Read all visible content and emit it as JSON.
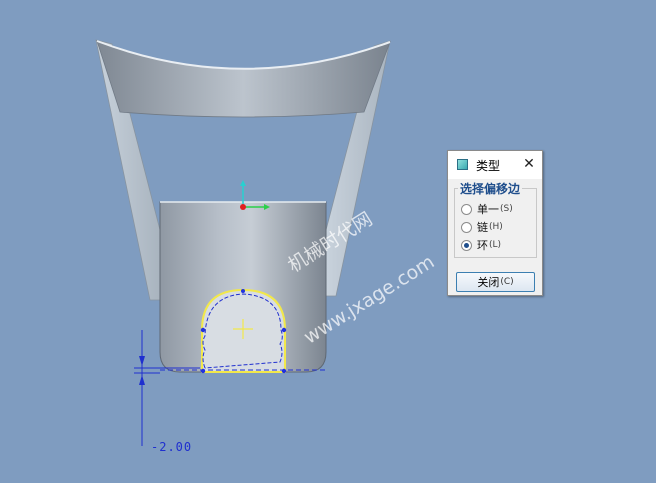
{
  "dialog": {
    "title": "类型",
    "close_glyph": "✕",
    "group_title": "选择偏移边",
    "options": [
      {
        "label": "单一",
        "key": "(S)",
        "checked": false
      },
      {
        "label": "链",
        "key": "(H)",
        "checked": false
      },
      {
        "label": "环",
        "key": "(L)",
        "checked": true
      }
    ],
    "close_button_label": "关闭",
    "close_button_key": "(C)"
  },
  "viewport": {
    "dimension_value": "-2.00",
    "background_color": "#7f9cc0",
    "highlight_color": "#f2e84a",
    "dimension_color": "#1f2fcf"
  },
  "watermark": {
    "line1": "机械时代网",
    "line2": "www.jxage.com"
  },
  "icons": {
    "title_icon": "feature-type-icon",
    "close_icon": "close-icon"
  }
}
